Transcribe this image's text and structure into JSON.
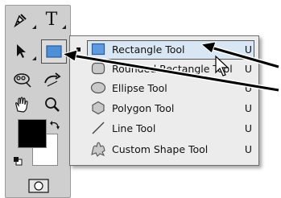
{
  "toolbox": {
    "tools": [
      {
        "name": "pen-icon"
      },
      {
        "name": "type-icon",
        "glyph": "T"
      },
      {
        "name": "path-selection-icon"
      },
      {
        "name": "rectangle-tool-icon"
      },
      {
        "name": "lasso-icon"
      },
      {
        "name": "rotate-view-icon"
      },
      {
        "name": "hand-icon"
      },
      {
        "name": "zoom-icon"
      },
      {
        "name": "swap-colors-icon"
      },
      {
        "name": "default-colors-icon"
      },
      {
        "name": "quick-mask-icon"
      }
    ],
    "foreground_color": "#000000",
    "background_color": "#ffffff",
    "active_tool_color": "#4f8fd6"
  },
  "flyout_menu": {
    "items": [
      {
        "label": "Rectangle Tool",
        "shortcut": "U",
        "icon": "rectangle-icon",
        "selected": true
      },
      {
        "label": "Rounded Rectangle Tool",
        "shortcut": "U",
        "icon": "rounded-rectangle-icon",
        "selected": false
      },
      {
        "label": "Ellipse Tool",
        "shortcut": "U",
        "icon": "ellipse-icon",
        "selected": false
      },
      {
        "label": "Polygon Tool",
        "shortcut": "U",
        "icon": "polygon-icon",
        "selected": false
      },
      {
        "label": "Line Tool",
        "shortcut": "U",
        "icon": "line-icon",
        "selected": false
      },
      {
        "label": "Custom Shape Tool",
        "shortcut": "U",
        "icon": "custom-shape-icon",
        "selected": false
      }
    ]
  },
  "annotations": {
    "arrow_color": "#000000"
  }
}
